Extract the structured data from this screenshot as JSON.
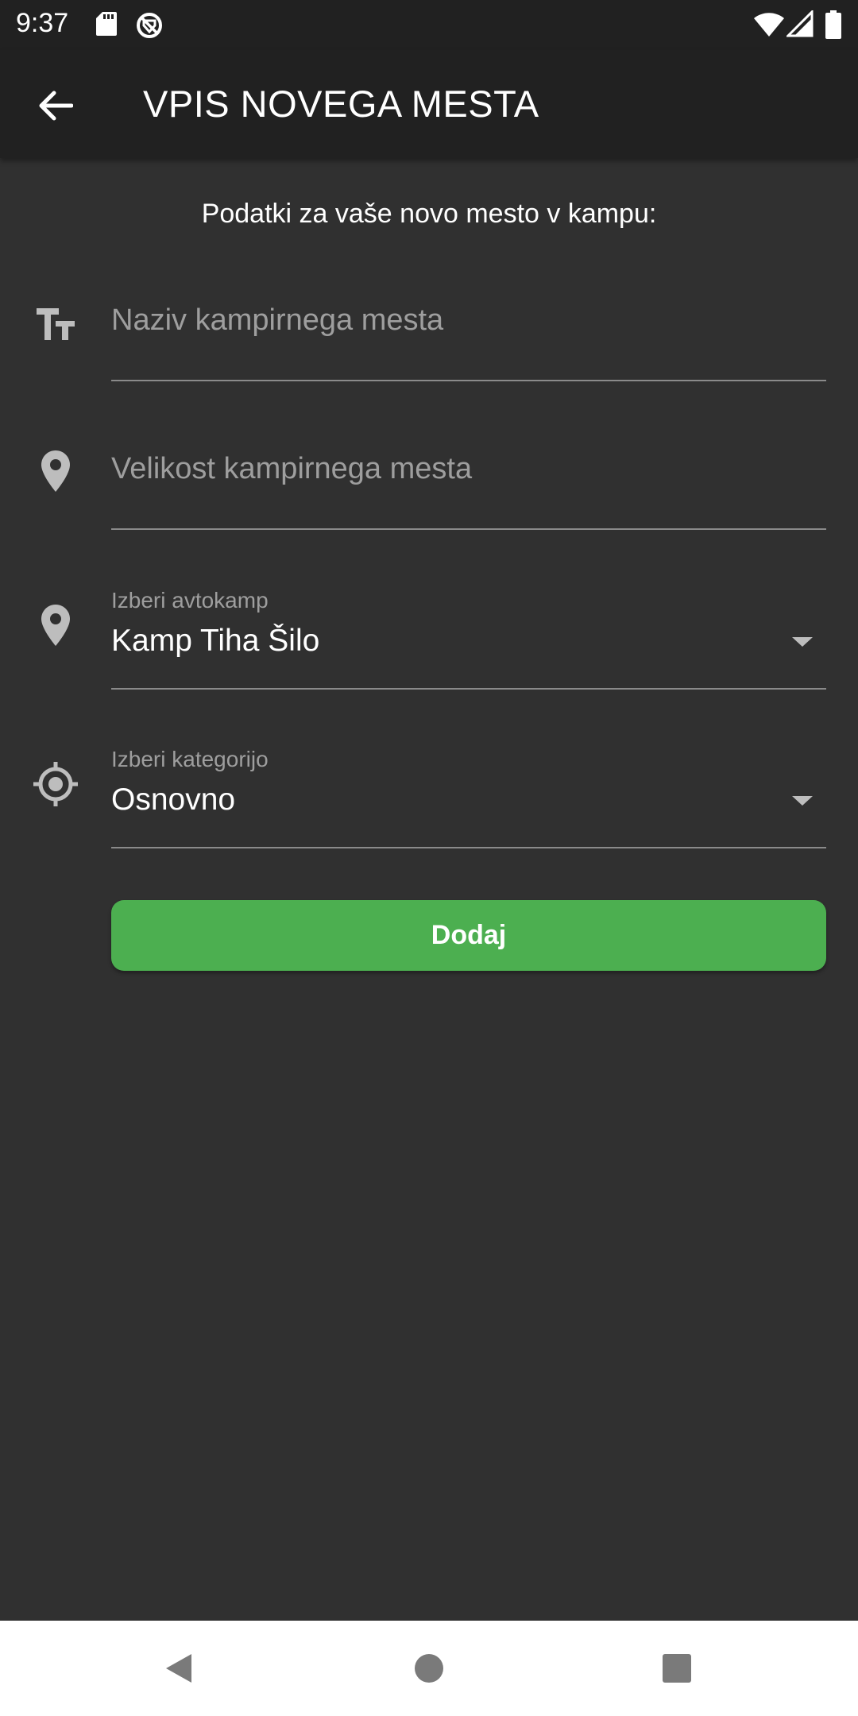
{
  "status_bar": {
    "time": "9:37",
    "left_icons": [
      "sd-card-icon",
      "no-location-icon"
    ],
    "right_icons": [
      "wifi-icon",
      "signal-icon",
      "battery-icon"
    ]
  },
  "app_bar": {
    "back_icon": "arrow-left-icon",
    "title": "VPIS NOVEGA MESTA"
  },
  "form": {
    "intro": "Podatki za vaše novo mesto v kampu:",
    "name_field": {
      "icon": "text-fields-icon",
      "placeholder": "Naziv kampirnega mesta",
      "value": ""
    },
    "size_field": {
      "icon": "location-pin-icon",
      "placeholder": "Velikost kampirnega mesta",
      "value": ""
    },
    "camp_select": {
      "icon": "location-pin-icon",
      "label": "Izberi avtokamp",
      "value": "Kamp Tiha Šilo"
    },
    "category_select": {
      "icon": "gps-target-icon",
      "label": "Izberi kategorijo",
      "value": "Osnovno"
    },
    "submit_label": "Dodaj"
  },
  "colors": {
    "background": "#303030",
    "app_bar": "#212121",
    "accent_button": "#4caf50",
    "hint_text": "#9e9e9e"
  },
  "nav_bar": {
    "buttons": [
      "back-triangle-icon",
      "home-circle-icon",
      "recents-square-icon"
    ]
  }
}
